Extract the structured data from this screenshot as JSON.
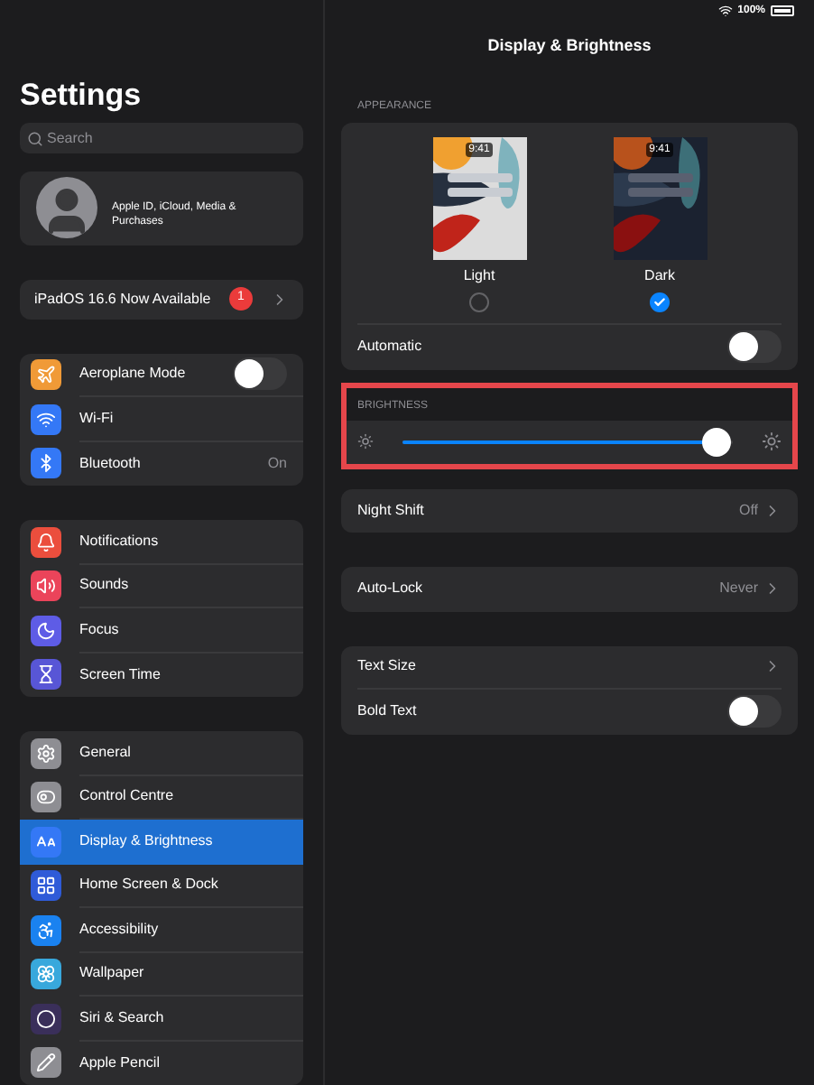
{
  "status_bar": {
    "battery": "100%"
  },
  "sidebar": {
    "title": "Settings",
    "search": {
      "placeholder": "Search"
    },
    "account": {
      "label": "Apple ID, iCloud, Media & Purchases"
    },
    "update": {
      "label": "iPadOS 16.6 Now Available",
      "badge": "1"
    },
    "groups": [
      [
        {
          "label": "Aeroplane Mode",
          "kind": "toggle",
          "on": false,
          "selected": false
        },
        {
          "label": "Wi-Fi",
          "kind": "plain",
          "selected": false
        },
        {
          "label": "Bluetooth",
          "kind": "value",
          "value": "On",
          "selected": false
        }
      ],
      [
        {
          "label": "Notifications",
          "kind": "plain",
          "selected": false
        },
        {
          "label": "Sounds",
          "kind": "plain",
          "selected": false
        },
        {
          "label": "Focus",
          "kind": "plain",
          "selected": false
        },
        {
          "label": "Screen Time",
          "kind": "plain",
          "selected": false
        }
      ],
      [
        {
          "label": "General",
          "kind": "plain",
          "selected": false
        },
        {
          "label": "Control Centre",
          "kind": "plain",
          "selected": false
        },
        {
          "label": "Display & Brightness",
          "kind": "plain",
          "selected": true
        },
        {
          "label": "Home Screen & Dock",
          "kind": "plain",
          "selected": false
        },
        {
          "label": "Accessibility",
          "kind": "plain",
          "selected": false
        },
        {
          "label": "Wallpaper",
          "kind": "plain",
          "selected": false
        },
        {
          "label": "Siri & Search",
          "kind": "plain",
          "selected": false
        },
        {
          "label": "Apple Pencil",
          "kind": "plain",
          "selected": false
        }
      ]
    ]
  },
  "detail": {
    "title": "Display & Brightness",
    "appearance": {
      "header": "APPEARANCE",
      "options": [
        {
          "label": "Light",
          "time": "9:41",
          "kind": "light",
          "selected": false
        },
        {
          "label": "Dark",
          "time": "9:41",
          "kind": "dark",
          "selected": true
        }
      ],
      "automatic": {
        "label": "Automatic",
        "on": false
      }
    },
    "brightness": {
      "header": "BRIGHTNESS",
      "level": 0.95,
      "highlighted": true
    },
    "groups": [
      [
        {
          "label": "Night Shift",
          "kind": "value",
          "value": "Off"
        }
      ],
      [
        {
          "label": "Auto-Lock",
          "kind": "value",
          "value": "Never"
        }
      ],
      [
        {
          "label": "Text Size",
          "kind": "chevron"
        },
        {
          "label": "Bold Text",
          "kind": "toggle",
          "on": false
        }
      ]
    ]
  }
}
